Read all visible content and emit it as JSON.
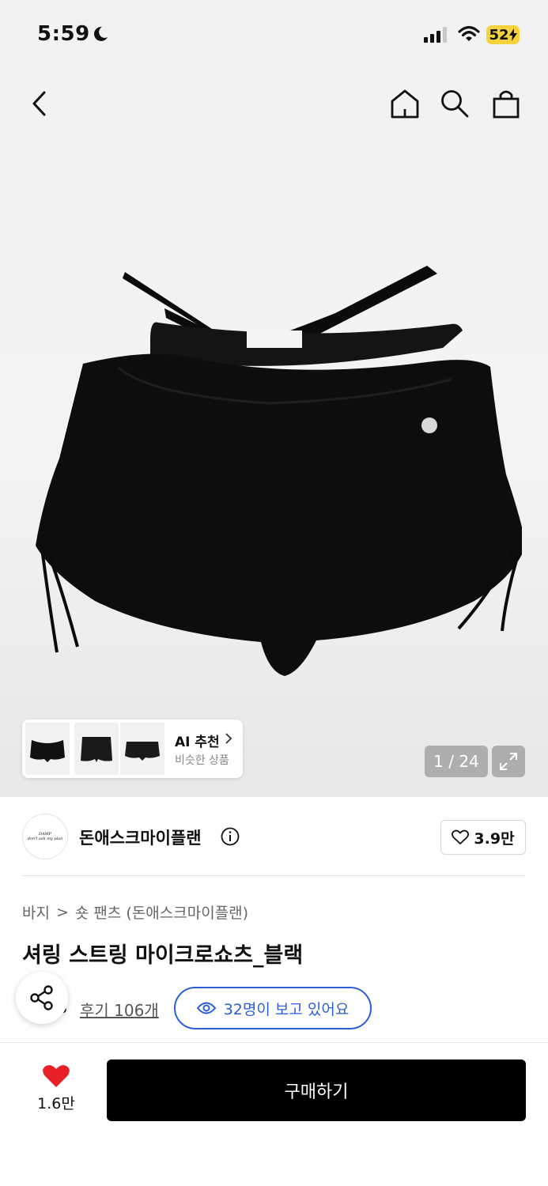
{
  "status_bar": {
    "time": "5:59",
    "battery": "52"
  },
  "gallery": {
    "ai_title": "AI 추천",
    "ai_subtitle": "비슷한 상품",
    "page_counter": "1 / 24"
  },
  "brand": {
    "name": "돈애스크마이플랜",
    "logo_text_top": "DAMP",
    "logo_text_bottom": "don't ask my plan",
    "likes": "3.9만"
  },
  "breadcrumb": {
    "category": "바지",
    "separator": ">",
    "subcategory": "숏 팬츠 (돈애스크마이플랜)"
  },
  "product": {
    "title": "셔링 스트링 마이크로쇼츠_블랙",
    "rating": ".8",
    "reviews": "후기 106개",
    "viewers": "32명이 보고 있어요"
  },
  "bottom_bar": {
    "like_count": "1.6만",
    "buy_label": "구매하기"
  },
  "colors": {
    "accent_blue": "#2c5fdc",
    "heart_red": "#e8202a",
    "buy_bg": "#000000"
  }
}
